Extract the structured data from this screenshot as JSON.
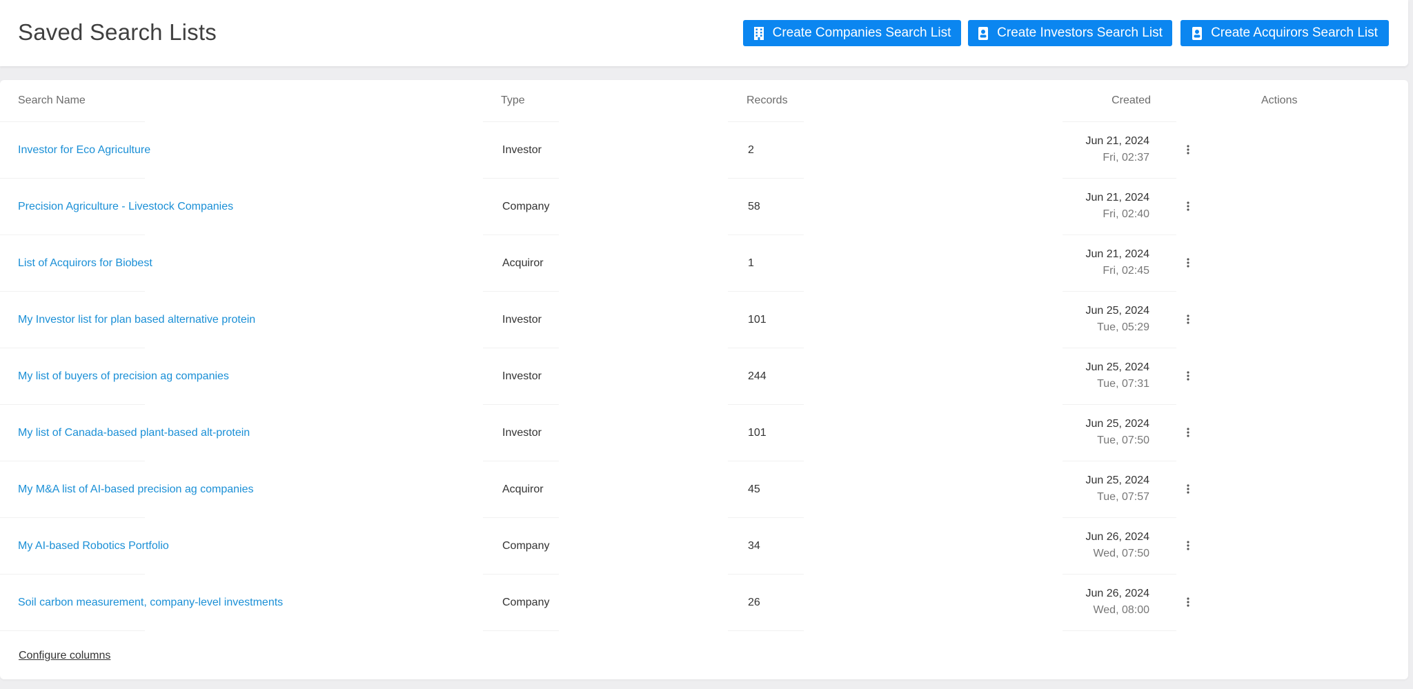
{
  "header": {
    "title": "Saved Search Lists",
    "buttons": {
      "companies": "Create Companies Search List",
      "investors": "Create Investors Search List",
      "acquirors": "Create Acquirors Search List"
    }
  },
  "colors": {
    "accent": "#0b86f0",
    "link": "#1a8fd6"
  },
  "table": {
    "columns": {
      "name": "Search Name",
      "type": "Type",
      "records": "Records",
      "created": "Created",
      "actions": "Actions"
    },
    "rows": [
      {
        "name": "Investor for Eco Agriculture",
        "type": "Investor",
        "records": "2",
        "date": "Jun 21, 2024",
        "time": "Fri, 02:37"
      },
      {
        "name": "Precision Agriculture - Livestock Companies",
        "type": "Company",
        "records": "58",
        "date": "Jun 21, 2024",
        "time": "Fri, 02:40"
      },
      {
        "name": "List of Acquirors for Biobest",
        "type": "Acquiror",
        "records": "1",
        "date": "Jun 21, 2024",
        "time": "Fri, 02:45"
      },
      {
        "name": "My Investor list for plan based alternative protein",
        "type": "Investor",
        "records": "101",
        "date": "Jun 25, 2024",
        "time": "Tue, 05:29"
      },
      {
        "name": "My list of buyers of precision ag companies",
        "type": "Investor",
        "records": "244",
        "date": "Jun 25, 2024",
        "time": "Tue, 07:31"
      },
      {
        "name": "My list of Canada-based plant-based alt-protein",
        "type": "Investor",
        "records": "101",
        "date": "Jun 25, 2024",
        "time": "Tue, 07:50"
      },
      {
        "name": "My M&A list of AI-based precision ag companies",
        "type": "Acquiror",
        "records": "45",
        "date": "Jun 25, 2024",
        "time": "Tue, 07:57"
      },
      {
        "name": "My AI-based Robotics Portfolio",
        "type": "Company",
        "records": "34",
        "date": "Jun 26, 2024",
        "time": "Wed, 07:50"
      },
      {
        "name": "Soil carbon measurement, company-level investments",
        "type": "Company",
        "records": "26",
        "date": "Jun 26, 2024",
        "time": "Wed, 08:00"
      }
    ],
    "row_icons": {
      "actions": "kebab-menu-icon"
    }
  },
  "footer": {
    "configure_columns": "Configure columns"
  }
}
